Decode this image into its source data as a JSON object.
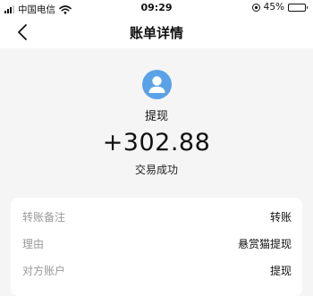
{
  "status_bar": {
    "carrier": "中国电信",
    "time": "09:29",
    "battery_percent": "45%",
    "battery_level": 0.45
  },
  "nav": {
    "title": "账单详情",
    "back_icon": "chevron-left-icon"
  },
  "summary": {
    "avatar_icon": "user-avatar-icon",
    "type": "提现",
    "amount": "+302.88",
    "status": "交易成功"
  },
  "details": [
    {
      "label": "转账备注",
      "value": "转账"
    },
    {
      "label": "理由",
      "value": "悬赏猫提现"
    },
    {
      "label": "对方账户",
      "value": "提现"
    }
  ],
  "colors": {
    "avatar_bg": "#5aa2e8",
    "page_bg": "#f5f5f5",
    "label_gray": "#999999"
  }
}
